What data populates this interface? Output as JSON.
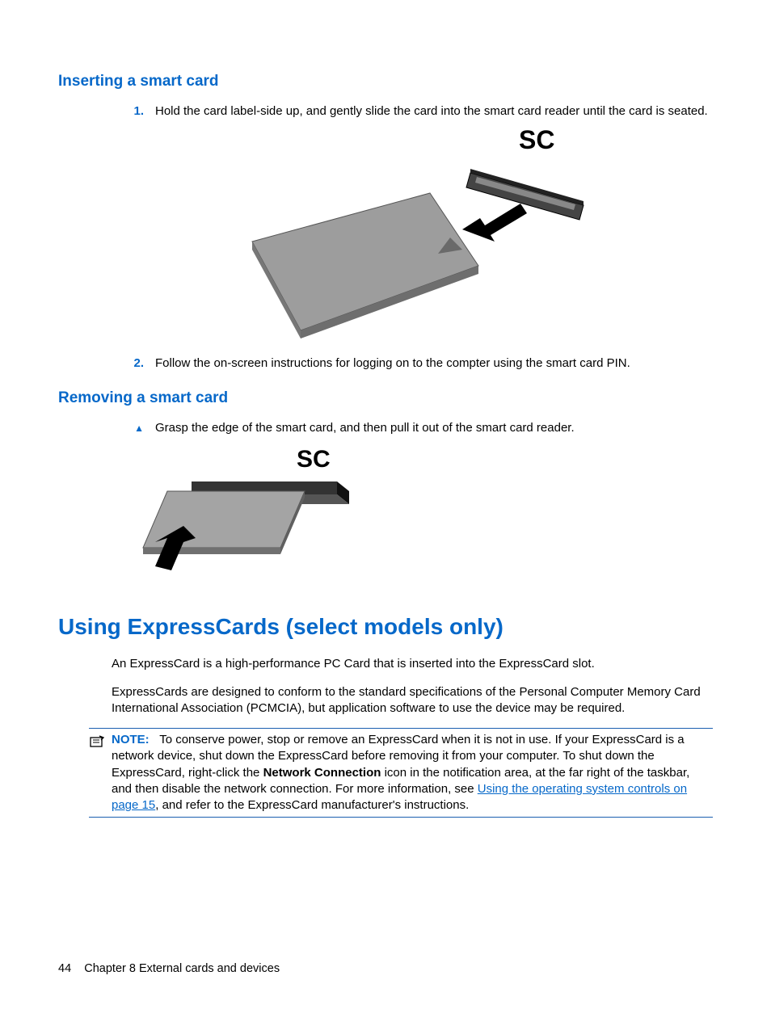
{
  "section1": {
    "heading": "Inserting a smart card",
    "step1_num": "1.",
    "step1_text": "Hold the card label-side up, and gently slide the card into the smart card reader until the card is seated.",
    "illustration_label": "SC",
    "step2_num": "2.",
    "step2_text": "Follow the on-screen instructions for logging on to the compter using the smart card PIN."
  },
  "section2": {
    "heading": "Removing a smart card",
    "bullet_text": "Grasp the edge of the smart card, and then pull it out of the smart card reader.",
    "illustration_label": "SC"
  },
  "section3": {
    "heading": "Using ExpressCards (select models only)",
    "para1": "An ExpressCard is a high-performance PC Card that is inserted into the ExpressCard slot.",
    "para2": "ExpressCards are designed to conform to the standard specifications of the Personal Computer Memory Card International Association (PCMCIA), but application software to use the device may be required.",
    "note_label": "NOTE:",
    "note_part1": "To conserve power, stop or remove an ExpressCard when it is not in use. If your ExpressCard is a network device, shut down the ExpressCard before removing it from your computer. To shut down the ExpressCard, right-click the ",
    "note_bold": "Network Connection",
    "note_part2": " icon in the notification area, at the far right of the taskbar, and then disable the network connection. For more information, see ",
    "note_link": "Using the operating system controls on page 15",
    "note_part3": ", and refer to the ExpressCard manufacturer's instructions."
  },
  "footer": {
    "page_num": "44",
    "chapter": "Chapter 8   External cards and devices"
  }
}
